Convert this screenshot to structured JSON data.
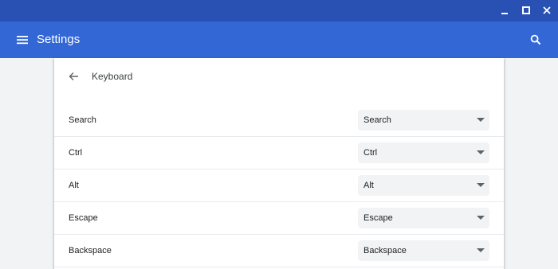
{
  "colors": {
    "titlebar": "#2951b3",
    "appbar": "#3367d6",
    "page_bg": "#f1f3f4",
    "card_bg": "#ffffff",
    "select_bg": "#f1f3f4"
  },
  "window_controls": {
    "icons": [
      "minimize-icon",
      "maximize-icon",
      "close-icon"
    ]
  },
  "appbar": {
    "title": "Settings",
    "menu_icon": "hamburger-menu-icon",
    "search_icon": "search-icon"
  },
  "subpage": {
    "back_icon": "arrow-back-icon",
    "title": "Keyboard"
  },
  "rows": [
    {
      "label": "Search",
      "selected": "Search"
    },
    {
      "label": "Ctrl",
      "selected": "Ctrl"
    },
    {
      "label": "Alt",
      "selected": "Alt"
    },
    {
      "label": "Escape",
      "selected": "Escape"
    },
    {
      "label": "Backspace",
      "selected": "Backspace"
    }
  ]
}
